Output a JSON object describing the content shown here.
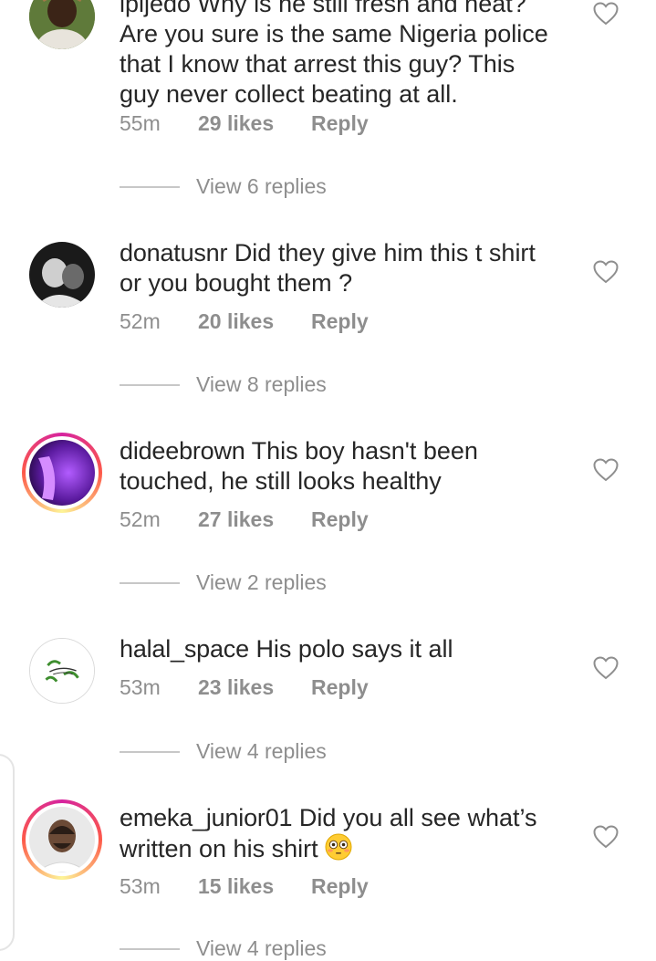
{
  "comments": [
    {
      "username": "ipijedo",
      "text": "Why is he still fresh and neat? Are you sure is the same Nigeria police that I know that arrest this guy? This guy never collect beating at all.",
      "line1": "Are you sure is the same Nigeria police",
      "line2": "that I know that arrest this guy? This",
      "line3": "guy never collect beating at all.",
      "head": "ipijedo Why is he still fresh and neat?",
      "time": "55m",
      "likes": "29 likes",
      "reply": "Reply",
      "view_replies": "View 6 replies"
    },
    {
      "username": "donatusnr",
      "text": "Did they give him this t shirt",
      "text2": "or you bought them ?",
      "time": "52m",
      "likes": "20 likes",
      "reply": "Reply",
      "view_replies": "View 8 replies"
    },
    {
      "username": "dideebrown",
      "text": "This boy hasn't been",
      "text2": "touched, he still looks healthy",
      "time": "52m",
      "likes": "27 likes",
      "reply": "Reply",
      "view_replies": "View 2 replies"
    },
    {
      "username": "halal_space",
      "text": "His polo says it all",
      "time": "53m",
      "likes": "23 likes",
      "reply": "Reply",
      "view_replies": "View 4 replies"
    },
    {
      "username": "emeka_junior01",
      "text": "Did you all see what’s",
      "text2": "written on his shirt",
      "emoji": "flushed-face",
      "time": "53m",
      "likes": "15 likes",
      "reply": "Reply",
      "view_replies": "View 4 replies"
    }
  ],
  "icons": {
    "like": "heart-outline-icon"
  },
  "colors": {
    "text": "#262626",
    "meta": "#8e8e8e",
    "divider": "#c7c7c7",
    "story_ring_start": "#d6249f",
    "story_ring_end": "#fd5949"
  }
}
